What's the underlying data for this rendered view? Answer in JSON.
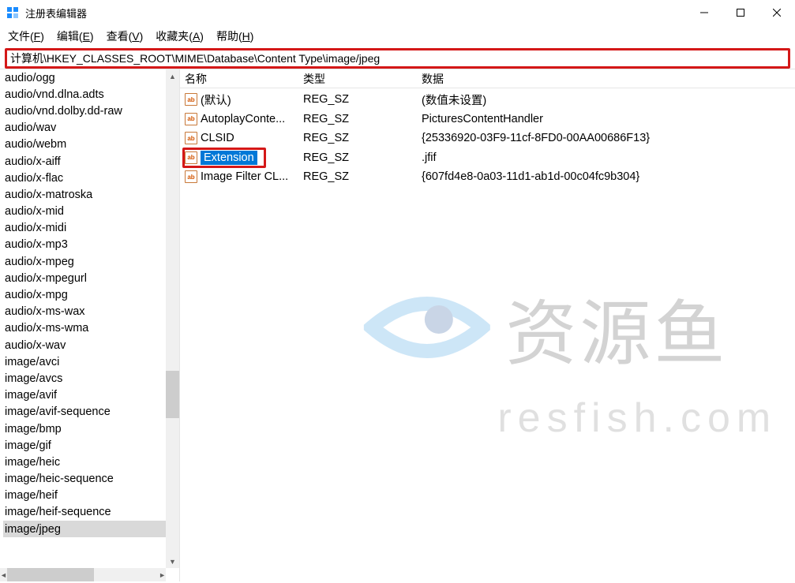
{
  "titlebar": {
    "title": "注册表编辑器"
  },
  "menubar": {
    "file": "文件",
    "file_key": "F",
    "edit": "编辑",
    "edit_key": "E",
    "view": "查看",
    "view_key": "V",
    "favorites": "收藏夹",
    "favorites_key": "A",
    "help": "帮助",
    "help_key": "H"
  },
  "address": "计算机\\HKEY_CLASSES_ROOT\\MIME\\Database\\Content Type\\image/jpeg",
  "tree": [
    "audio/ogg",
    "audio/vnd.dlna.adts",
    "audio/vnd.dolby.dd-raw",
    "audio/wav",
    "audio/webm",
    "audio/x-aiff",
    "audio/x-flac",
    "audio/x-matroska",
    "audio/x-mid",
    "audio/x-midi",
    "audio/x-mp3",
    "audio/x-mpeg",
    "audio/x-mpegurl",
    "audio/x-mpg",
    "audio/x-ms-wax",
    "audio/x-ms-wma",
    "audio/x-wav",
    "image/avci",
    "image/avcs",
    "image/avif",
    "image/avif-sequence",
    "image/bmp",
    "image/gif",
    "image/heic",
    "image/heic-sequence",
    "image/heif",
    "image/heif-sequence",
    "image/jpeg"
  ],
  "tree_selected_index": 27,
  "columns": {
    "name": "名称",
    "type": "类型",
    "data": "数据"
  },
  "rows": [
    {
      "name": "(默认)",
      "type": "REG_SZ",
      "data": "(数值未设置)"
    },
    {
      "name": "AutoplayConte...",
      "type": "REG_SZ",
      "data": "PicturesContentHandler"
    },
    {
      "name": "CLSID",
      "type": "REG_SZ",
      "data": "{25336920-03F9-11cf-8FD0-00AA00686F13}"
    },
    {
      "name": "Extension",
      "type": "REG_SZ",
      "data": ".jfif"
    },
    {
      "name": "Image Filter CL...",
      "type": "REG_SZ",
      "data": "{607fd4e8-0a03-11d1-ab1d-00c04fc9b304}"
    }
  ],
  "selected_row_index": 3,
  "watermark": {
    "cn": "资源鱼",
    "en": "resfish.com"
  }
}
